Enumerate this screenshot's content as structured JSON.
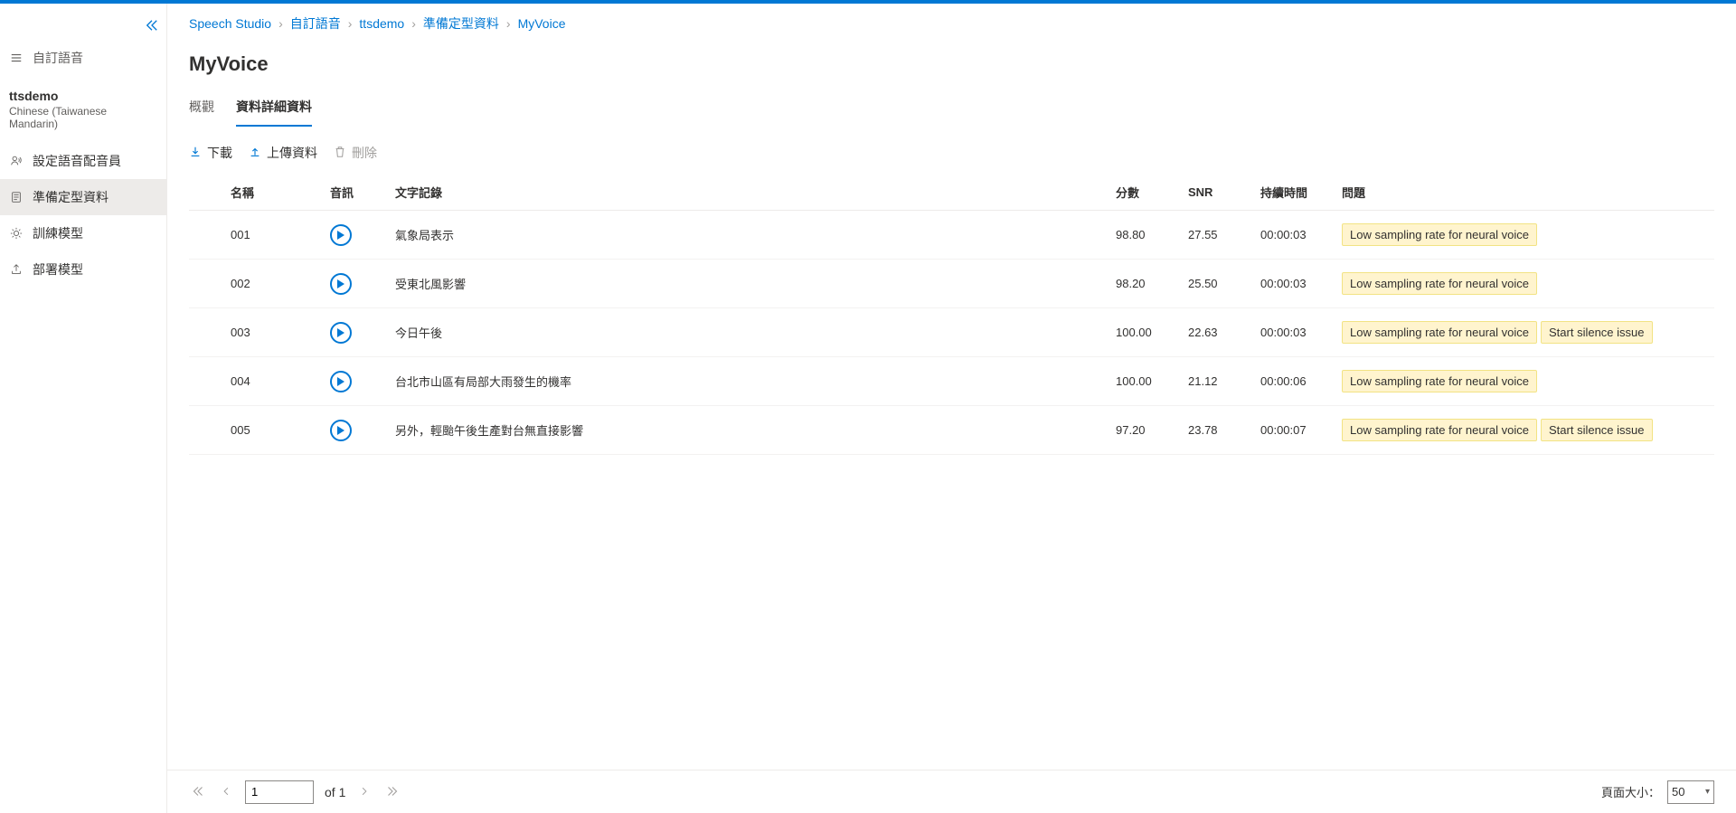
{
  "breadcrumbs": [
    "Speech Studio",
    "自訂語音",
    "ttsdemo",
    "準備定型資料",
    "MyVoice"
  ],
  "sidebar": {
    "section_label": "自訂語音",
    "project_name": "ttsdemo",
    "project_lang": "Chinese (Taiwanese Mandarin)",
    "items": [
      {
        "label": "設定語音配音員"
      },
      {
        "label": "準備定型資料"
      },
      {
        "label": "訓練模型"
      },
      {
        "label": "部署模型"
      }
    ]
  },
  "page_title": "MyVoice",
  "tabs": {
    "overview": "概觀",
    "details": "資料詳細資料"
  },
  "toolbar": {
    "download": "下載",
    "upload": "上傳資料",
    "delete": "刪除"
  },
  "columns": {
    "name": "名稱",
    "audio": "音訊",
    "text": "文字記錄",
    "score": "分數",
    "snr": "SNR",
    "duration": "持續時間",
    "issue": "問題"
  },
  "rows": [
    {
      "name": "001",
      "text": "氣象局表示",
      "score": "98.80",
      "snr": "27.55",
      "duration": "00:00:03",
      "issues": [
        "Low sampling rate for neural voice"
      ]
    },
    {
      "name": "002",
      "text": "受東北風影響",
      "score": "98.20",
      "snr": "25.50",
      "duration": "00:00:03",
      "issues": [
        "Low sampling rate for neural voice"
      ]
    },
    {
      "name": "003",
      "text": "今日午後",
      "score": "100.00",
      "snr": "22.63",
      "duration": "00:00:03",
      "issues": [
        "Low sampling rate for neural voice",
        "Start silence issue"
      ]
    },
    {
      "name": "004",
      "text": "台北市山區有局部大雨發生的機率",
      "score": "100.00",
      "snr": "21.12",
      "duration": "00:00:06",
      "issues": [
        "Low sampling rate for neural voice"
      ]
    },
    {
      "name": "005",
      "text": "另外，輕颱午後生產對台無直接影響",
      "score": "97.20",
      "snr": "23.78",
      "duration": "00:00:07",
      "issues": [
        "Low sampling rate for neural voice",
        "Start silence issue"
      ]
    }
  ],
  "pager": {
    "page": "1",
    "of_label": "of 1",
    "page_size_label": "頁面大小：",
    "page_size": "50"
  }
}
